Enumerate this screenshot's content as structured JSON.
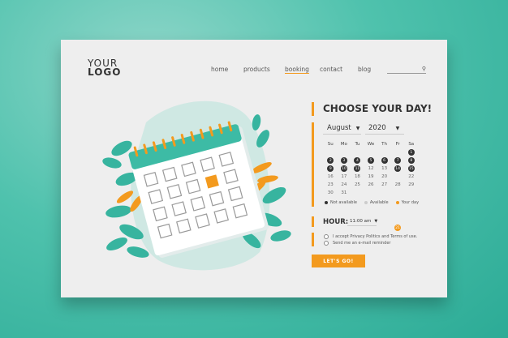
{
  "logo": {
    "line1": "YOUR",
    "line2": "LOGO"
  },
  "nav": {
    "home": "home",
    "products": "products",
    "booking": "booking",
    "contact": "contact",
    "blog": "blog"
  },
  "search": {
    "icon": "search-icon"
  },
  "booking": {
    "title": "CHOOSE YOUR DAY!",
    "month": "August",
    "year": "2020",
    "weekdays": [
      "Su",
      "Mo",
      "Tu",
      "We",
      "Th",
      "Fr",
      "Sa"
    ],
    "weeks": [
      [
        "",
        "",
        "",
        "",
        "",
        "",
        "1"
      ],
      [
        "2",
        "3",
        "4",
        "5",
        "6",
        "7",
        "8"
      ],
      [
        "9",
        "10",
        "11",
        "12",
        "13",
        "14",
        "15"
      ],
      [
        "16",
        "17",
        "18",
        "19",
        "20",
        "21",
        "22"
      ],
      [
        "23",
        "24",
        "25",
        "26",
        "27",
        "28",
        "29"
      ],
      [
        "30",
        "31",
        "",
        "",
        "",
        "",
        ""
      ]
    ],
    "not_available": [
      "1",
      "2",
      "3",
      "4",
      "5",
      "6",
      "7",
      "8",
      "9",
      "10",
      "11",
      "14",
      "15"
    ],
    "selected_day": "21",
    "legend": {
      "not_available": "Not available",
      "available": "Available",
      "your_day": "Your day"
    },
    "hour_label": "HOUR:",
    "hour_value": "11:00 am",
    "privacy_text": "I accept Privacy Politics and Terms of use.",
    "reminder_text": "Send me an e-mail reminder",
    "cta_label": "LET'S GO!"
  },
  "colors": {
    "accent": "#f39a1e",
    "teal": "#3dbba5",
    "not_available": "#333333"
  }
}
